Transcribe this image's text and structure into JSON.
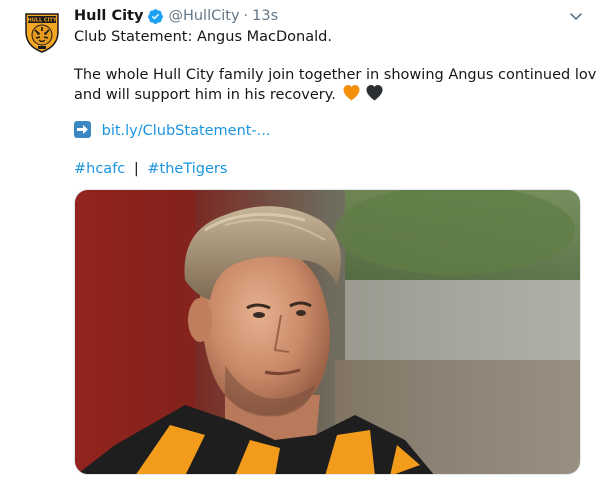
{
  "tweet": {
    "display_name": "Hull City",
    "handle": "@HullCity",
    "separator": "·",
    "time": "13s",
    "line1": "Club Statement: Angus MacDonald.",
    "line2": "The whole Hull City family join together in showing Angus continued love",
    "line3": "and will support him in his recovery.",
    "link_text": "bit.ly/ClubStatement-...",
    "hashtag1": "#hcafc",
    "pipe": "|",
    "hashtag2": "#theTigers"
  },
  "avatar": {
    "logo_text": "HULL CITY",
    "icon": "tiger-crest-icon"
  },
  "icons": {
    "verified": "verified-badge-icon",
    "caret": "chevron-down-icon",
    "arrow": "right-arrow-emoji-icon",
    "heart_orange": "orange-heart-emoji-icon",
    "heart_black": "black-heart-emoji-icon"
  },
  "colors": {
    "text": "#14171a",
    "muted": "#657786",
    "link": "#1b95e0",
    "verified": "#1da1f2",
    "club_amber": "#f5a623"
  }
}
